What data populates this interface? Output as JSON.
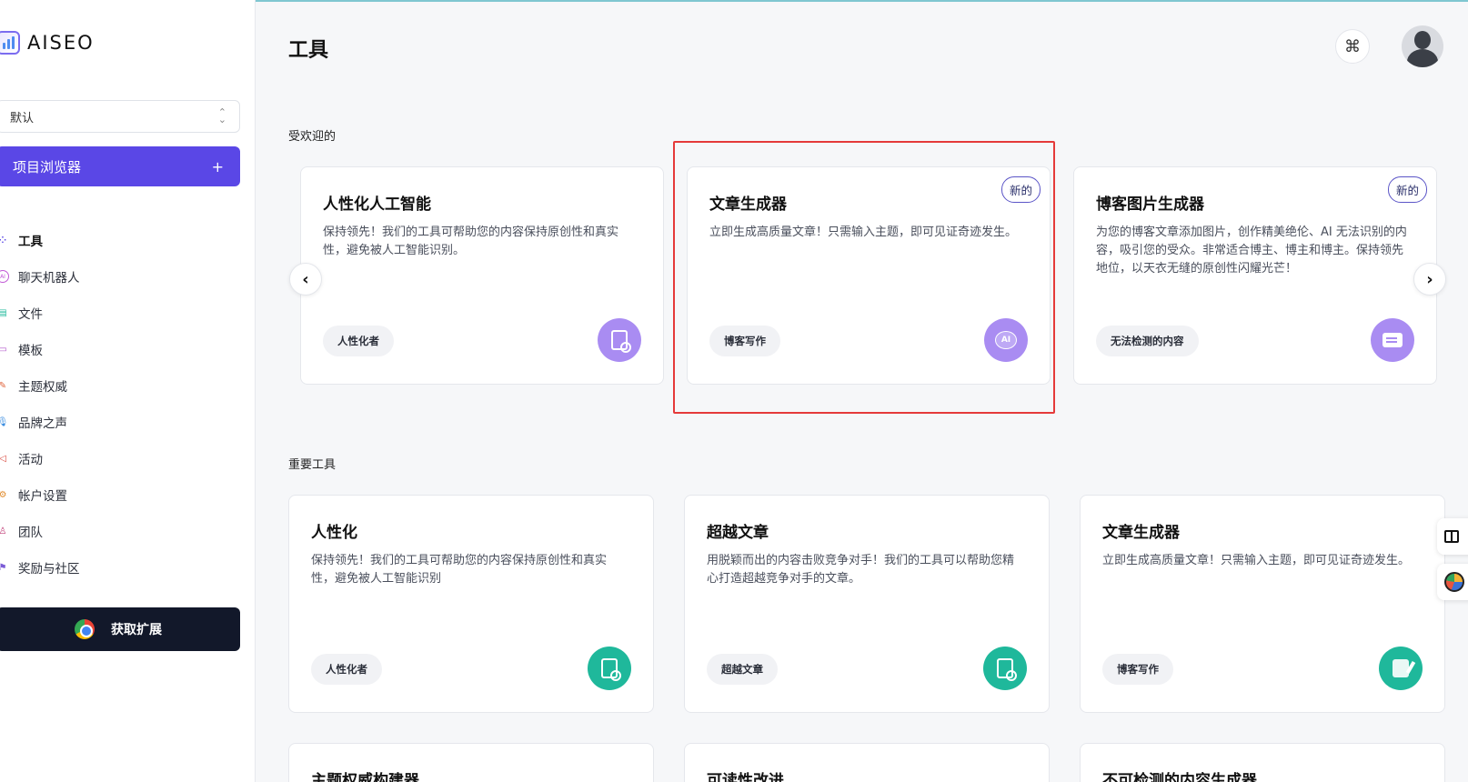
{
  "app": {
    "name": "AISEO"
  },
  "sidebar": {
    "project_select": "默认",
    "project_button": {
      "label": "项目浏览器",
      "plus": "+"
    },
    "nav": [
      {
        "label": "工具",
        "icon": "grid-icon",
        "active": true
      },
      {
        "label": "聊天机器人",
        "icon": "ai-chat-icon"
      },
      {
        "label": "文件",
        "icon": "file-icon"
      },
      {
        "label": "模板",
        "icon": "template-icon"
      },
      {
        "label": "主题权威",
        "icon": "topic-icon"
      },
      {
        "label": "品牌之声",
        "icon": "microphone-icon"
      },
      {
        "label": "活动",
        "icon": "megaphone-icon"
      },
      {
        "label": "帐户设置",
        "icon": "gear-icon"
      },
      {
        "label": "团队",
        "icon": "team-icon"
      },
      {
        "label": "奖励与社区",
        "icon": "gift-icon"
      }
    ],
    "extension_button": "获取扩展"
  },
  "header": {
    "title": "工具",
    "command_symbol": "⌘"
  },
  "popular": {
    "label": "受欢迎的",
    "prev_arrow": "‹",
    "next_arrow": "›",
    "cards": [
      {
        "title": "人性化人工智能",
        "desc": "保持领先！我们的工具可帮助您的内容保持原创性和真实性，避免被人工智能识别。",
        "tag": "人性化者",
        "icon": "document-search-icon",
        "badge": ""
      },
      {
        "title": "文章生成器",
        "desc": "立即生成高质量文章！只需输入主题，即可见证奇迹发生。",
        "tag": "博客写作",
        "icon": "ai-chat-icon",
        "icon_text": "AI",
        "badge": "新的"
      },
      {
        "title": "博客图片生成器",
        "desc": "为您的博客文章添加图片，创作精美绝伦、AI 无法识别的内容，吸引您的受众。非常适合博主、博主和博主。保持领先地位，以天衣无缝的原创性闪耀光芒！",
        "tag": "无法检测的内容",
        "icon": "screen-icon",
        "badge": "新的"
      }
    ]
  },
  "important": {
    "label": "重要工具",
    "cards": [
      {
        "title": "人性化",
        "desc": "保持领先！我们的工具可帮助您的内容保持原创性和真实性，避免被人工智能识别",
        "tag": "人性化者",
        "icon": "document-search-icon"
      },
      {
        "title": "超越文章",
        "desc": "用脱颖而出的内容击败竞争对手！我们的工具可以帮助您精心打造超越竞争对手的文章。",
        "tag": "超越文章",
        "icon": "document-search-icon"
      },
      {
        "title": "文章生成器",
        "desc": "立即生成高质量文章！只需输入主题，即可见证奇迹发生。",
        "tag": "博客写作",
        "icon": "edit-document-icon"
      }
    ],
    "next_row_titles": [
      "主题权威构建器",
      "可读性改进",
      "不可检测的内容生成器"
    ]
  },
  "colors": {
    "primary": "#5a47e6",
    "purple_icon": "#a98cf2",
    "teal_icon": "#1fb89b",
    "highlight": "#e53a3a"
  }
}
